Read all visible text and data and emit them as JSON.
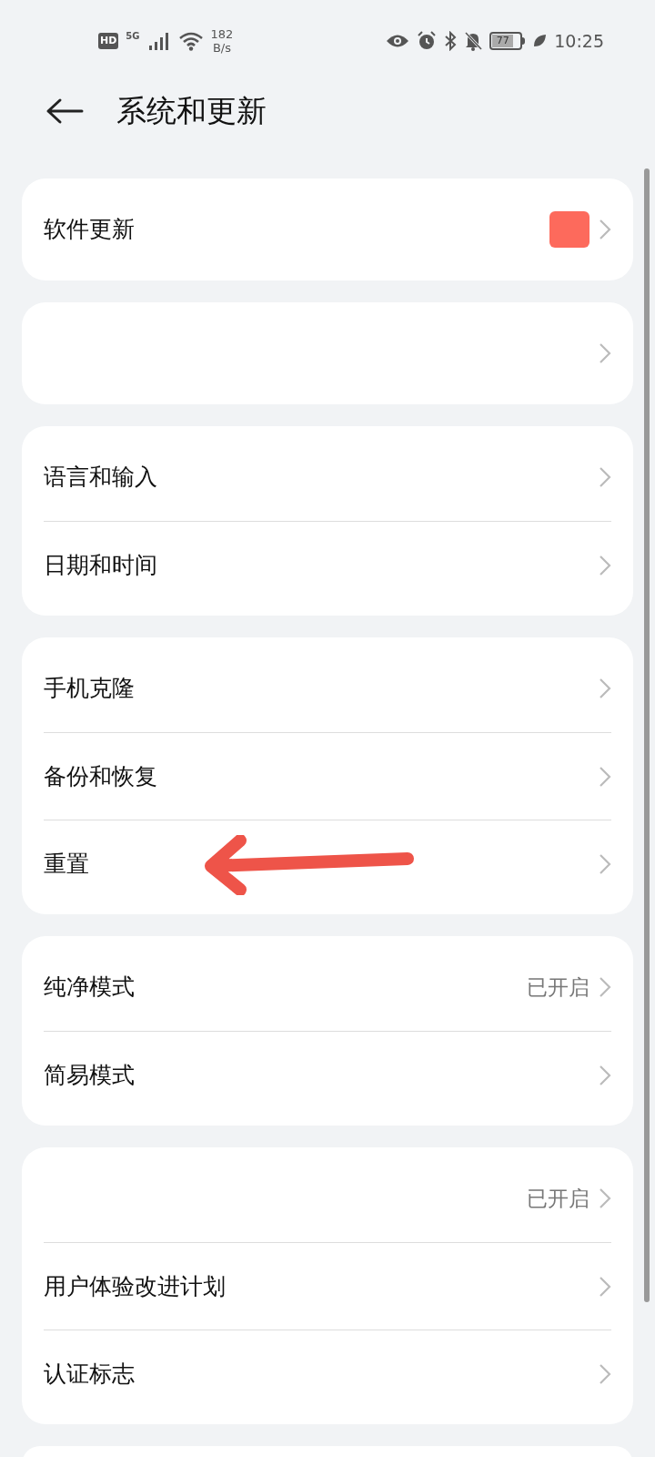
{
  "status_bar": {
    "hd_label": "HD",
    "network": "5G",
    "speed_value": "182",
    "speed_unit": "B/s",
    "battery": "77",
    "time": "10:25"
  },
  "header": {
    "title": "系统和更新"
  },
  "groups": [
    {
      "items": [
        {
          "label": "软件更新",
          "badge": true,
          "chevron": true
        }
      ]
    },
    {
      "items": [
        {
          "chevron": true
        }
      ]
    },
    {
      "items": [
        {
          "label": "语言和输入",
          "chevron": true
        },
        {
          "label": "日期和时间",
          "chevron": true
        }
      ]
    },
    {
      "items": [
        {
          "label": "手机克隆",
          "chevron": true
        },
        {
          "label": "备份和恢复",
          "chevron": true
        },
        {
          "label": "重置",
          "annotated": true,
          "chevron": true
        }
      ]
    },
    {
      "items": [
        {
          "label": "纯净模式",
          "value": "已开启",
          "chevron": true
        },
        {
          "label": "简易模式",
          "chevron": true
        }
      ]
    },
    {
      "items": [
        {
          "value": "已开启",
          "chevron": true
        },
        {
          "label": "用户体验改进计划",
          "chevron": true
        },
        {
          "label": "认证标志",
          "chevron": true
        }
      ]
    }
  ]
}
